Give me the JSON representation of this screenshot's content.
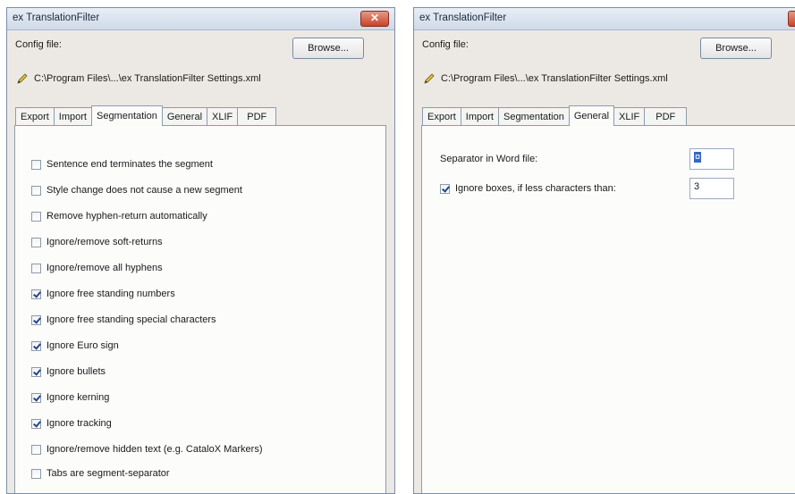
{
  "left": {
    "title": "ex TranslationFilter",
    "close": "✕",
    "config_label": "Config file:",
    "browse_label": "Browse...",
    "path": "C:\\Program Files\\...\\ex TranslationFilter Settings.xml",
    "tabs": [
      "Export",
      "Import",
      "Segmentation",
      "General",
      "XLIF",
      "PDF"
    ],
    "active_tab": "Segmentation",
    "options": [
      {
        "label": "Sentence end terminates the segment",
        "checked": false
      },
      {
        "label": "Style change does not cause a new segment",
        "checked": false
      },
      {
        "label": "Remove hyphen-return automatically",
        "checked": false
      },
      {
        "label": "Ignore/remove soft-returns",
        "checked": false
      },
      {
        "label": "Ignore/remove all hyphens",
        "checked": false
      },
      {
        "label": "Ignore free standing numbers",
        "checked": true
      },
      {
        "label": "Ignore free standing special characters",
        "checked": true
      },
      {
        "label": "Ignore Euro sign",
        "checked": true
      },
      {
        "label": "Ignore bullets",
        "checked": true
      },
      {
        "label": "Ignore kerning",
        "checked": true
      },
      {
        "label": "Ignore tracking",
        "checked": true
      },
      {
        "label": "Ignore/remove hidden text (e.g. CataloX Markers)",
        "checked": false
      },
      {
        "label": "Tabs are segment-separator",
        "checked": false
      }
    ]
  },
  "right": {
    "title": "ex TranslationFilter",
    "close": "✕",
    "config_label": "Config file:",
    "browse_label": "Browse...",
    "path": "C:\\Program Files\\...\\ex TranslationFilter Settings.xml",
    "tabs": [
      "Export",
      "Import",
      "Segmentation",
      "General",
      "XLIF",
      "PDF"
    ],
    "active_tab": "General",
    "separator_label": "Separator in Word file:",
    "separator_value": "¤",
    "ignore_boxes_label": "Ignore boxes, if less characters than:",
    "ignore_boxes_checked": true,
    "ignore_boxes_value": "3"
  },
  "icons": {
    "path_icon": "pencil-icon",
    "close_icon": "close-icon"
  }
}
